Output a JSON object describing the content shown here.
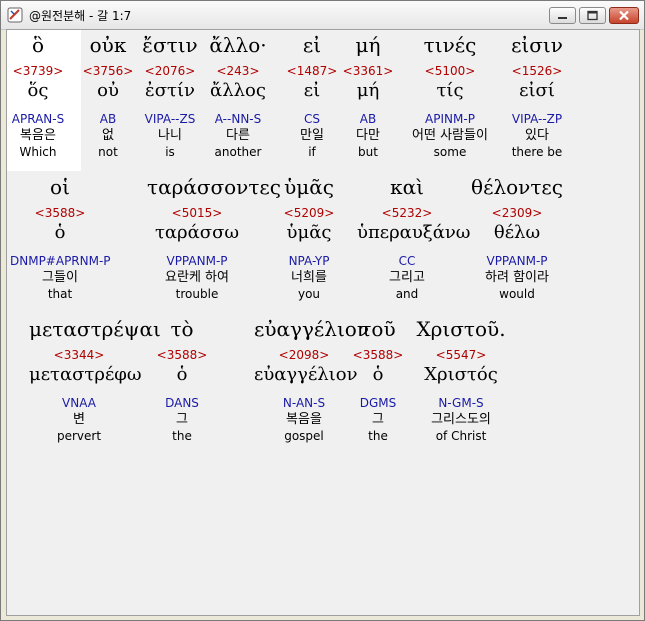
{
  "window": {
    "title": "@원전분해 - 갈 1:7",
    "minimize_glyph": "─",
    "maximize_glyph": "□",
    "close_glyph": "✕"
  },
  "rows": [
    [
      {
        "greek": "ὃ",
        "strong": "<3739>",
        "lemma": "ὅς",
        "morph": "APRAN-S",
        "korean": "복음은",
        "english": "Which"
      },
      {
        "greek": "οὐκ",
        "strong": "<3756>",
        "lemma": "οὐ",
        "morph": "AB",
        "korean": "없",
        "english": "not"
      },
      {
        "greek": "ἔστιν",
        "strong": "<2076>",
        "lemma": "ἐστίν",
        "morph": "VIPA--ZS",
        "korean": "나니",
        "english": "is"
      },
      {
        "greek": "ἄλλο·",
        "strong": "<243>",
        "lemma": "ἄλλος",
        "morph": "A--NN-S",
        "korean": "다른",
        "english": "another"
      },
      {
        "greek": "εἰ",
        "strong": "<1487>",
        "lemma": "εἰ",
        "morph": "CS",
        "korean": "만일",
        "english": "if"
      },
      {
        "greek": "μή",
        "strong": "<3361>",
        "lemma": "μή",
        "morph": "AB",
        "korean": "다만",
        "english": "but"
      },
      {
        "greek": "τινές",
        "strong": "<5100>",
        "lemma": "τίς",
        "morph": "APINM-P",
        "korean": "어떤 사람들이",
        "english": "some"
      },
      {
        "greek": "εἰσιν",
        "strong": "<1526>",
        "lemma": "εἰσί",
        "morph": "VIPA--ZP",
        "korean": "있다",
        "english": "there be"
      }
    ],
    [
      {
        "greek": "οἱ",
        "strong": "<3588>",
        "lemma": "ὁ",
        "morph": "DNMP#APRNM-P",
        "korean": "그들이",
        "english": "that"
      },
      {
        "greek": "ταράσσοντες",
        "strong": "<5015>",
        "lemma": "ταράσσω",
        "morph": "VPPANM-P",
        "korean": "요란케 하여",
        "english": "trouble"
      },
      {
        "greek": "ὑμᾶς",
        "strong": "<5209>",
        "lemma": "ὑμᾶς",
        "morph": "NPA-YP",
        "korean": "너희를",
        "english": "you"
      },
      {
        "greek": "καὶ",
        "strong": "<5232>",
        "lemma": "ὑπεραυξάνω",
        "morph": "CC",
        "korean": "그리고",
        "english": "and"
      },
      {
        "greek": "θέλοντες",
        "strong": "<2309>",
        "lemma": "θέλω",
        "morph": "VPPANM-P",
        "korean": "하려 함이라",
        "english": "would"
      }
    ],
    [
      {
        "greek": "μεταστρέψαι",
        "strong": "<3344>",
        "lemma": "μεταστρέφω",
        "morph": "VNAA",
        "korean": "변",
        "english": "pervert"
      },
      {
        "greek": "τὸ",
        "strong": "<3588>",
        "lemma": "ὁ",
        "morph": "DANS",
        "korean": "그",
        "english": "the"
      },
      {
        "greek": "εὐαγγέλιον",
        "strong": "<2098>",
        "lemma": "εὐαγγέλιον",
        "morph": "N-AN-S",
        "korean": "복음을",
        "english": "gospel"
      },
      {
        "greek": "τοῦ",
        "strong": "<3588>",
        "lemma": "ὁ",
        "morph": "DGMS",
        "korean": "그",
        "english": "the"
      },
      {
        "greek": "Χριστοῦ.",
        "strong": "<5547>",
        "lemma": "Χριστός",
        "morph": "N-GM-S",
        "korean": "그리스도의",
        "english": "of Christ"
      }
    ]
  ]
}
